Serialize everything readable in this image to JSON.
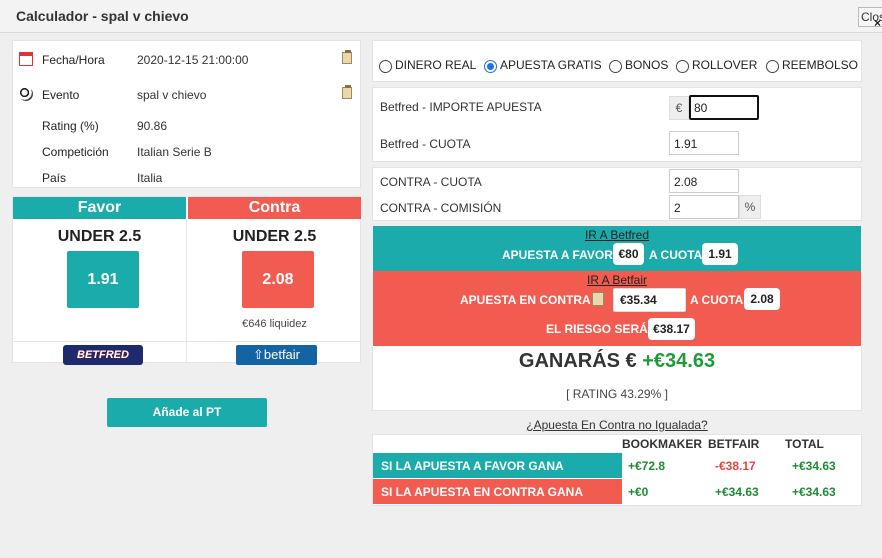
{
  "window": {
    "title": "Calculador - spal v chievo",
    "close_label": "Close",
    "close_icon": "×"
  },
  "info": {
    "rows": [
      {
        "label": "Fecha/Hora",
        "value": "2020-12-15 21:00:00"
      },
      {
        "label": "Evento",
        "value": "spal v chievo"
      },
      {
        "label": "Rating (%)",
        "value": "90.86"
      },
      {
        "label": "Competición",
        "value": "Italian Serie B"
      },
      {
        "label": "País",
        "value": "Italia"
      }
    ]
  },
  "odds": {
    "favor": {
      "header": "Favor",
      "market": "UNDER 2.5",
      "odd": "1.91",
      "bookmaker_logo": "BETFRED",
      "color": "#1cabab"
    },
    "contra": {
      "header": "Contra",
      "market": "UNDER 2.5",
      "odd": "2.08",
      "liquidity": "€646 liquidez",
      "exchange_logo": "betfair",
      "color": "#f15b50"
    }
  },
  "add_pt_button": "Añade al PT",
  "bet_types": [
    {
      "label": "DINERO REAL",
      "selected": false
    },
    {
      "label": "APUESTA GRATIS",
      "selected": true
    },
    {
      "label": "BONOS",
      "selected": false
    },
    {
      "label": "ROLLOVER",
      "selected": false
    },
    {
      "label": "REEMBOLSO",
      "selected": false
    }
  ],
  "form": {
    "importe_label": "Betfred - IMPORTE APUESTA",
    "currency_symbol": "€",
    "importe_value": "80",
    "cuota_label": "Betfred - CUOTA",
    "cuota_value": "1.91",
    "contra_cuota_label": "CONTRA - CUOTA",
    "contra_cuota_value": "2.08",
    "comision_label": "CONTRA - COMISIÓN",
    "comision_value": "2",
    "percent_symbol": "%"
  },
  "instructions": {
    "favor_link": "IR A Betfred",
    "favor_prefix": "APUESTA A FAVOR",
    "favor_amount": "€80",
    "favor_cuota_label": "A CUOTA",
    "favor_cuota": "1.91",
    "contra_link": "IR A Betfair",
    "contra_prefix": "APUESTA EN CONTRA",
    "contra_amount": "€35.34",
    "contra_cuota_label": "A CUOTA",
    "contra_cuota": "2.08",
    "risk_label": "EL RIESGO SERÁ",
    "risk_amount": "€38.17"
  },
  "result": {
    "label": "GANARÁS €",
    "amount": "+€34.63",
    "rating": "[ RATING 43.29% ]"
  },
  "table": {
    "link": "¿Apuesta En Contra no Igualada?",
    "headers": [
      "BOOKMAKER",
      "BETFAIR",
      "TOTAL"
    ],
    "rows": [
      {
        "label": "SI LA APUESTA A FAVOR GANA",
        "bookmaker": "+€72.8",
        "betfair": "-€38.17",
        "total": "+€34.63"
      },
      {
        "label": "SI LA APUESTA EN CONTRA GANA",
        "bookmaker": "+€0",
        "betfair": "+€34.63",
        "total": "+€34.63"
      }
    ]
  }
}
